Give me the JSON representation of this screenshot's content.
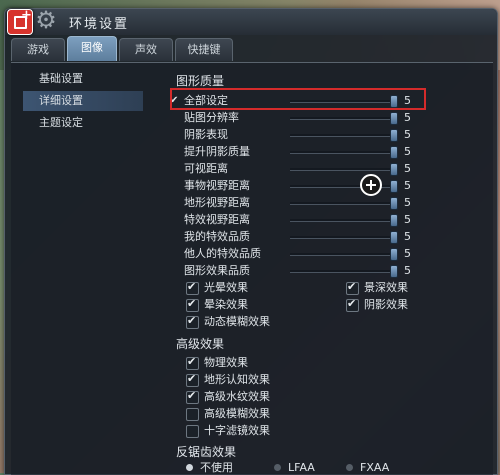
{
  "window": {
    "title": "环境设置"
  },
  "tabs": [
    {
      "label": "游戏",
      "active": false
    },
    {
      "label": "图像",
      "active": true
    },
    {
      "label": "声效",
      "active": false
    },
    {
      "label": "快捷键",
      "active": false
    }
  ],
  "sidebar": {
    "items": [
      {
        "label": "基础设置",
        "active": false
      },
      {
        "label": "详细设置",
        "active": true
      },
      {
        "label": "主题设定",
        "active": false
      }
    ]
  },
  "graphics": {
    "title": "图形质量",
    "rows": [
      {
        "label": "全部设定",
        "checked": true,
        "value": "5",
        "level": 1.0
      },
      {
        "label": "贴图分辨率",
        "checked": false,
        "value": "5",
        "level": 1.0
      },
      {
        "label": "阴影表现",
        "checked": false,
        "value": "5",
        "level": 1.0
      },
      {
        "label": "提升阴影质量",
        "checked": false,
        "value": "5",
        "level": 1.0
      },
      {
        "label": "可视距离",
        "checked": false,
        "value": "5",
        "level": 1.0
      },
      {
        "label": "事物视野距离",
        "checked": false,
        "value": "5",
        "level": 1.0
      },
      {
        "label": "地形视野距离",
        "checked": false,
        "value": "5",
        "level": 1.0
      },
      {
        "label": "特效视野距离",
        "checked": false,
        "value": "5",
        "level": 1.0
      },
      {
        "label": "我的特效品质",
        "checked": false,
        "value": "5",
        "level": 1.0
      },
      {
        "label": "他人的特效品质",
        "checked": false,
        "value": "5",
        "level": 1.0
      },
      {
        "label": "图形效果品质",
        "checked": false,
        "value": "5",
        "level": 1.0
      }
    ],
    "effects": [
      {
        "label": "光晕效果",
        "checked": true
      },
      {
        "label": "景深效果",
        "checked": true
      },
      {
        "label": "晕染效果",
        "checked": true
      },
      {
        "label": "阴影效果",
        "checked": true
      },
      {
        "label": "动态模糊效果",
        "checked": true
      }
    ]
  },
  "advanced": {
    "title": "高级效果",
    "items": [
      {
        "label": "物理效果",
        "checked": true
      },
      {
        "label": "地形认知效果",
        "checked": true
      },
      {
        "label": "高级水纹效果",
        "checked": true
      },
      {
        "label": "高级模糊效果",
        "checked": false
      },
      {
        "label": "十字滤镜效果",
        "checked": false
      }
    ]
  },
  "antialias": {
    "title": "反锯齿效果",
    "options": [
      {
        "label": "不使用",
        "selected": true
      },
      {
        "label": "LFAA",
        "selected": false
      },
      {
        "label": "FXAA",
        "selected": false
      }
    ]
  },
  "colors": {
    "active_tab": "#6f93b5",
    "highlight_border": "#d42b2b"
  }
}
